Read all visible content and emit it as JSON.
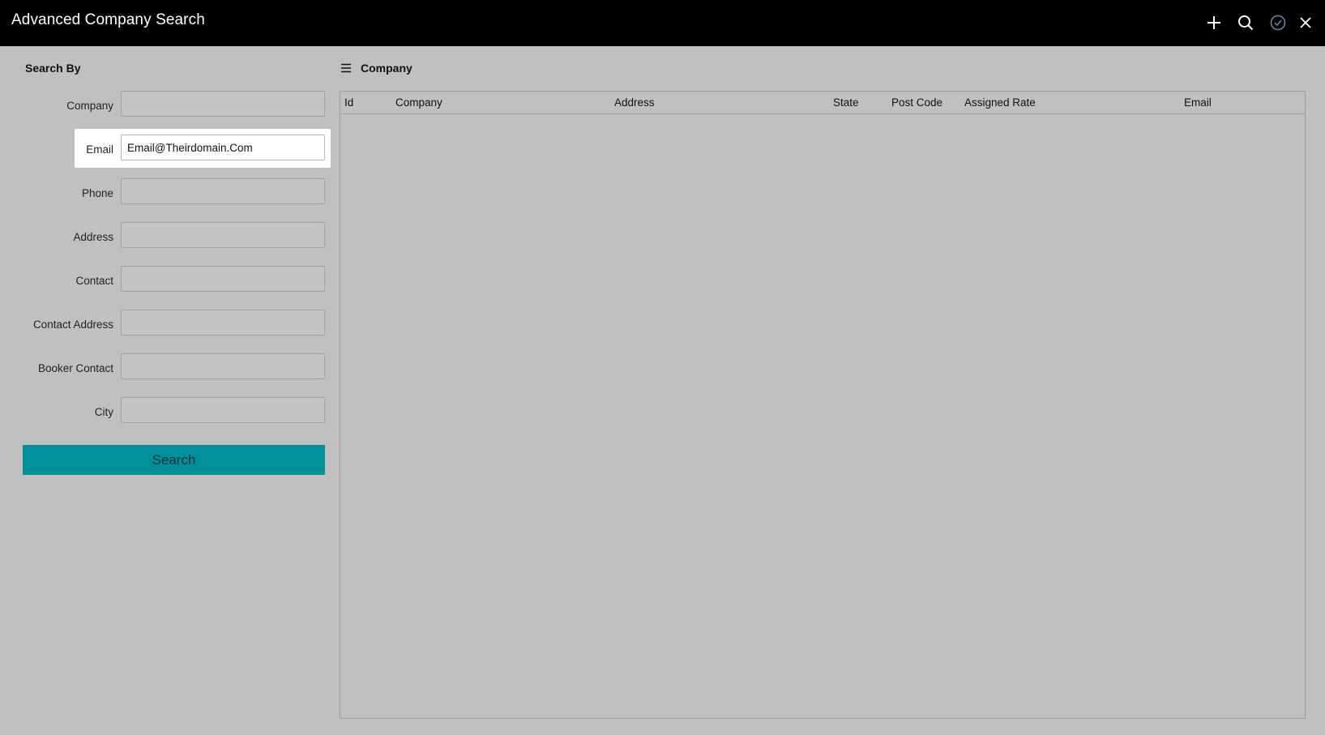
{
  "window": {
    "title": "Advanced Company Search",
    "icons": [
      "plus-icon",
      "search-icon",
      "check-circle-icon",
      "close-icon"
    ]
  },
  "search_panel": {
    "heading": "Search By",
    "fields": [
      {
        "label": "Company",
        "value": ""
      },
      {
        "label": "Email",
        "value": "Email@Theirdomain.Com"
      },
      {
        "label": "Phone",
        "value": ""
      },
      {
        "label": "Address",
        "value": ""
      },
      {
        "label": "Contact",
        "value": ""
      },
      {
        "label": "Contact Address",
        "value": ""
      },
      {
        "label": "Booker Contact",
        "value": ""
      },
      {
        "label": "City",
        "value": ""
      }
    ],
    "search_label": "Search"
  },
  "results": {
    "heading": "Company",
    "columns": [
      "Id",
      "Company",
      "Address",
      "State",
      "Post Code",
      "Assigned Rate",
      "Email"
    ],
    "rows": []
  },
  "colors": {
    "titlebar": "#000000",
    "background": "#c0c0c0",
    "accent": "#00909a",
    "highlight": "#ffffff"
  }
}
